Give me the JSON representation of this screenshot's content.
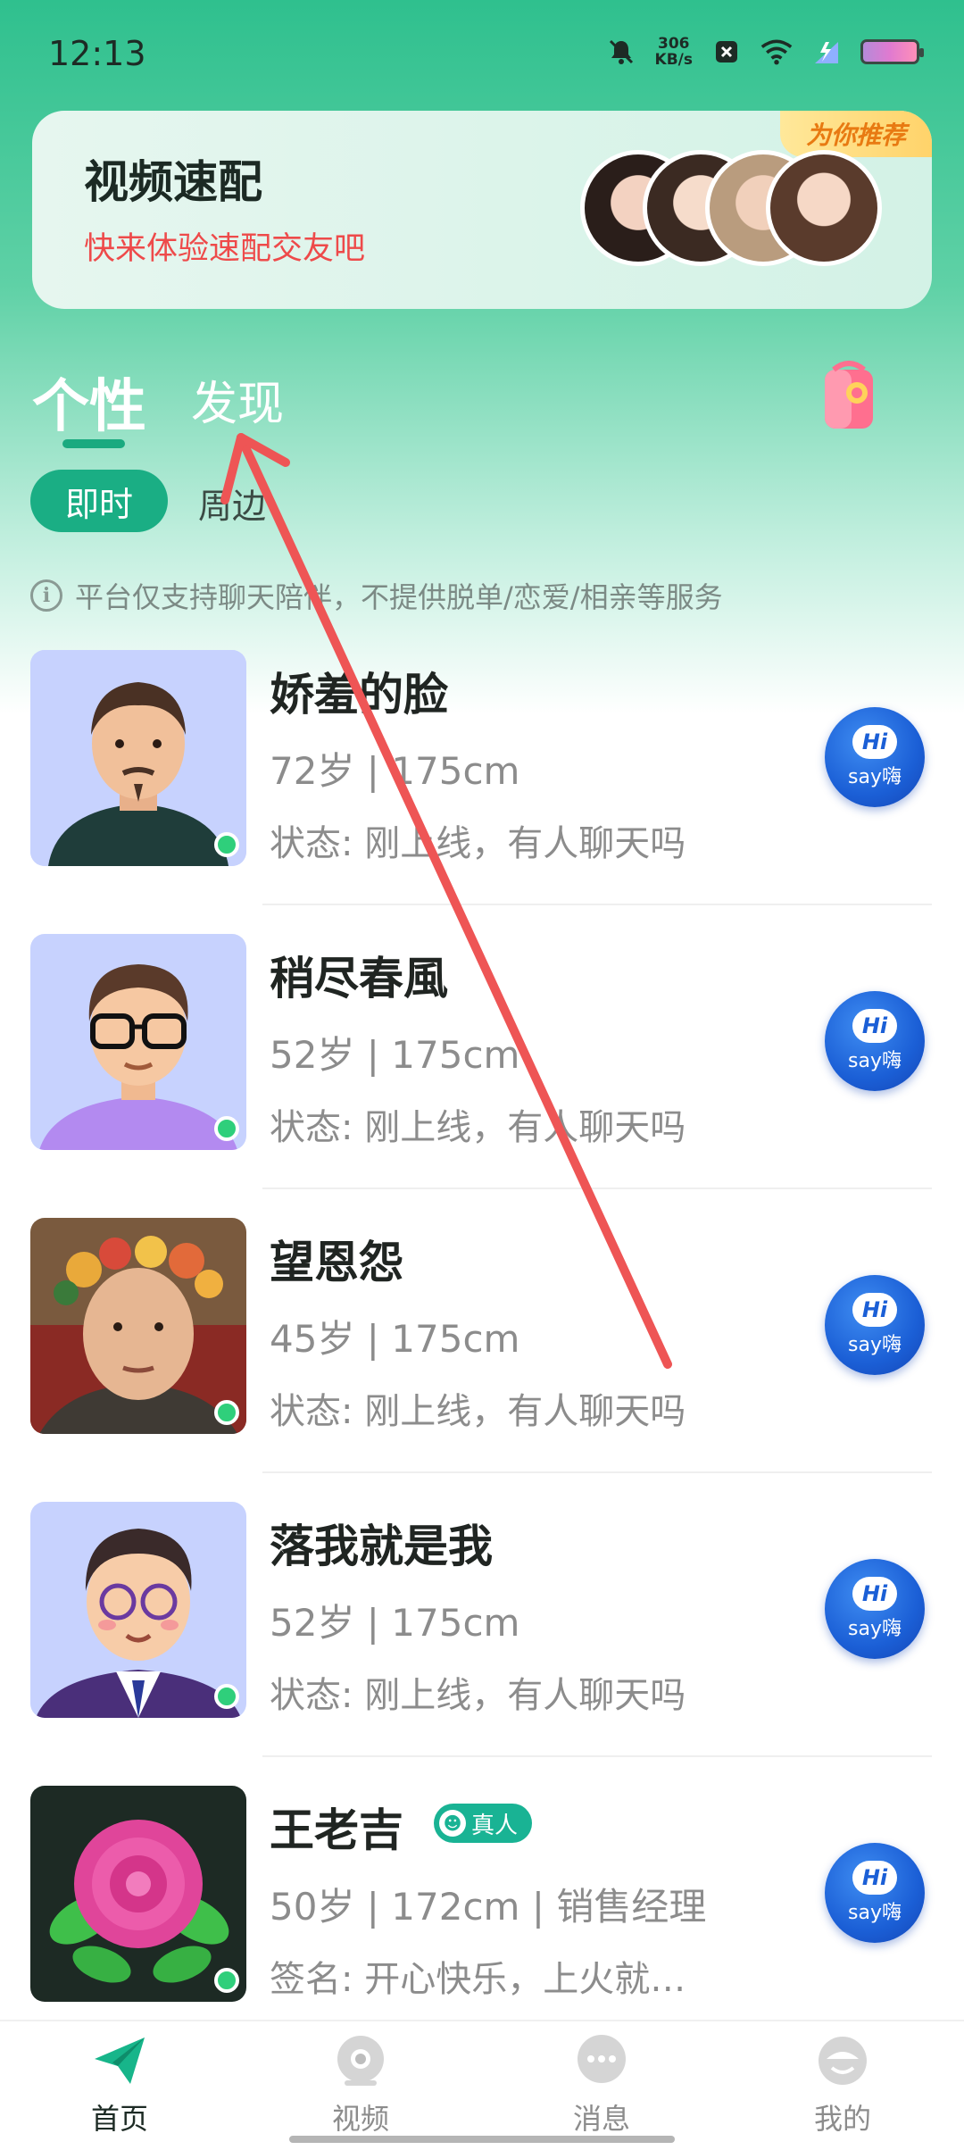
{
  "status_bar": {
    "time": "12:13",
    "net_speed_value": "306",
    "net_speed_unit": "KB/s"
  },
  "banner": {
    "title": "视频速配",
    "subtitle": "快来体验速配交友吧",
    "tag": "为你推荐"
  },
  "tabs": {
    "main": "个性",
    "discover": "发现"
  },
  "filters": {
    "active": "即时",
    "other": "周边"
  },
  "notice": "平台仅支持聊天陪伴，不提供脱单/恋爱/相亲等服务",
  "say_button": {
    "hi": "Hi",
    "label": "say嗨"
  },
  "users": [
    {
      "name": "娇羞的脸",
      "meta": "72岁 | 175cm",
      "status": "状态: 刚上线，有人聊天吗"
    },
    {
      "name": "稍尽春風",
      "meta": "52岁 | 175cm",
      "status": "状态: 刚上线，有人聊天吗"
    },
    {
      "name": "望恩怨",
      "meta": "45岁 | 175cm",
      "status": "状态: 刚上线，有人聊天吗"
    },
    {
      "name": "落我就是我",
      "meta": "52岁 | 175cm",
      "status": "状态: 刚上线，有人聊天吗"
    },
    {
      "name": "王老吉",
      "badge": "真人",
      "meta": "50岁 | 172cm | 销售经理",
      "status": "签名: 开心快乐，上火就…"
    }
  ],
  "nav": {
    "home": "首页",
    "video": "视频",
    "messages": "消息",
    "mine": "我的"
  },
  "colors": {
    "accent": "#1aae84",
    "annotation_arrow": "#ee5555"
  }
}
